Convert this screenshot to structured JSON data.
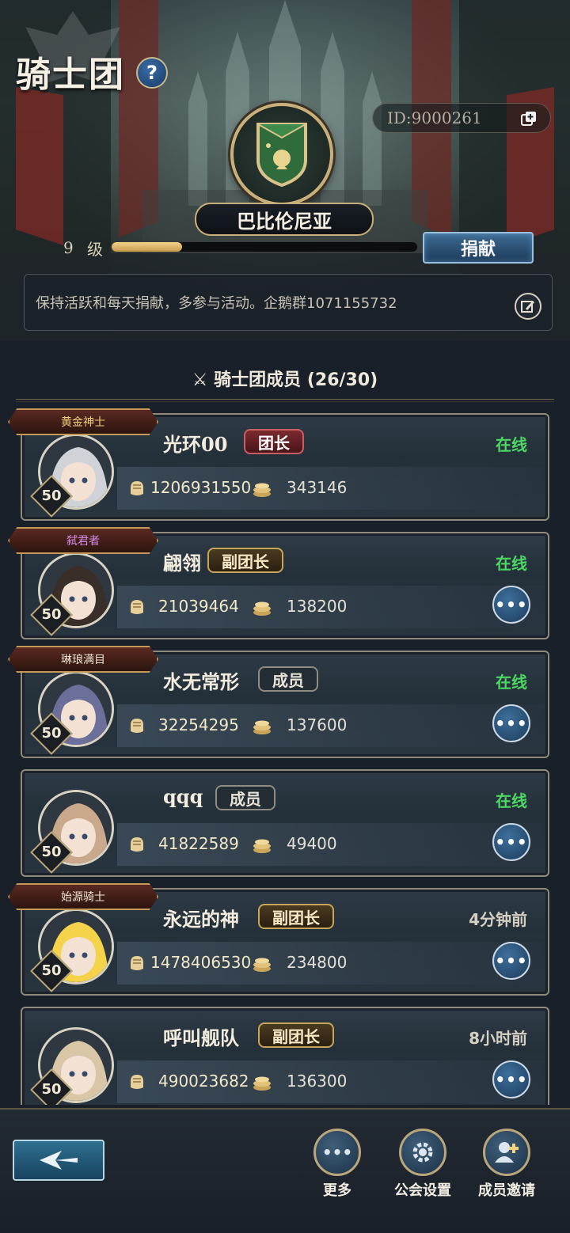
{
  "header": {
    "title": "骑士团",
    "help_label": "?",
    "id_text": "ID:9000261"
  },
  "guild": {
    "name": "巴比伦尼亚",
    "level": "9",
    "level_unit": "级",
    "level_progress": 0.23,
    "donate_label": "捐献",
    "notice": "保持活跃和每天捐献，多参与活动。企鹅群1071155732"
  },
  "members_section": {
    "title": "骑士团成员 (26/30)"
  },
  "members": [
    {
      "title_tag": "黄金神士",
      "name": "光环00",
      "role": "团长",
      "role_type": "leader",
      "status": "在线",
      "online": true,
      "level": "50",
      "stat1": "1206931550",
      "stat2": "343146",
      "has_more": false,
      "tag_color": "#f2d27a",
      "avatar_color": "#cfd3d8"
    },
    {
      "title_tag": "弑君者",
      "name": "翩翎",
      "role": "副团长",
      "role_type": "vice",
      "status": "在线",
      "online": true,
      "level": "50",
      "stat1": "21039464",
      "stat2": "138200",
      "has_more": true,
      "tag_color": "#d78be8",
      "avatar_color": "#3a2e28"
    },
    {
      "title_tag": "琳琅满目",
      "name": "水无常形",
      "role": "成员",
      "role_type": "member",
      "status": "在线",
      "online": true,
      "level": "50",
      "stat1": "32254295",
      "stat2": "137600",
      "has_more": true,
      "tag_color": "#f0e6d6",
      "avatar_color": "#6c6f9a"
    },
    {
      "title_tag": "",
      "name": "qqq",
      "role": "成员",
      "role_type": "member",
      "status": "在线",
      "online": true,
      "level": "50",
      "stat1": "41822589",
      "stat2": "49400",
      "has_more": true,
      "tag_color": "",
      "avatar_color": "#c9a88b"
    },
    {
      "title_tag": "始源骑士",
      "name": "永远的神",
      "role": "副团长",
      "role_type": "vice",
      "status": "4分钟前",
      "online": false,
      "level": "50",
      "stat1": "1478406530",
      "stat2": "234800",
      "has_more": true,
      "tag_color": "#f0e6d6",
      "avatar_color": "#f4d24a"
    },
    {
      "title_tag": "",
      "name": "呼叫舰队",
      "role": "副团长",
      "role_type": "vice",
      "status": "8小时前",
      "online": false,
      "level": "50",
      "stat1": "490023682",
      "stat2": "136300",
      "has_more": true,
      "tag_color": "",
      "avatar_color": "#d9c6a6"
    }
  ],
  "footer": {
    "more_label": "更多",
    "settings_label": "公会设置",
    "invite_label": "成员邀请",
    "more_glyph": "•••"
  },
  "colors": {
    "online": "#4cd963",
    "gold": "#c9b07a",
    "accent_blue": "#2f6f8f"
  }
}
